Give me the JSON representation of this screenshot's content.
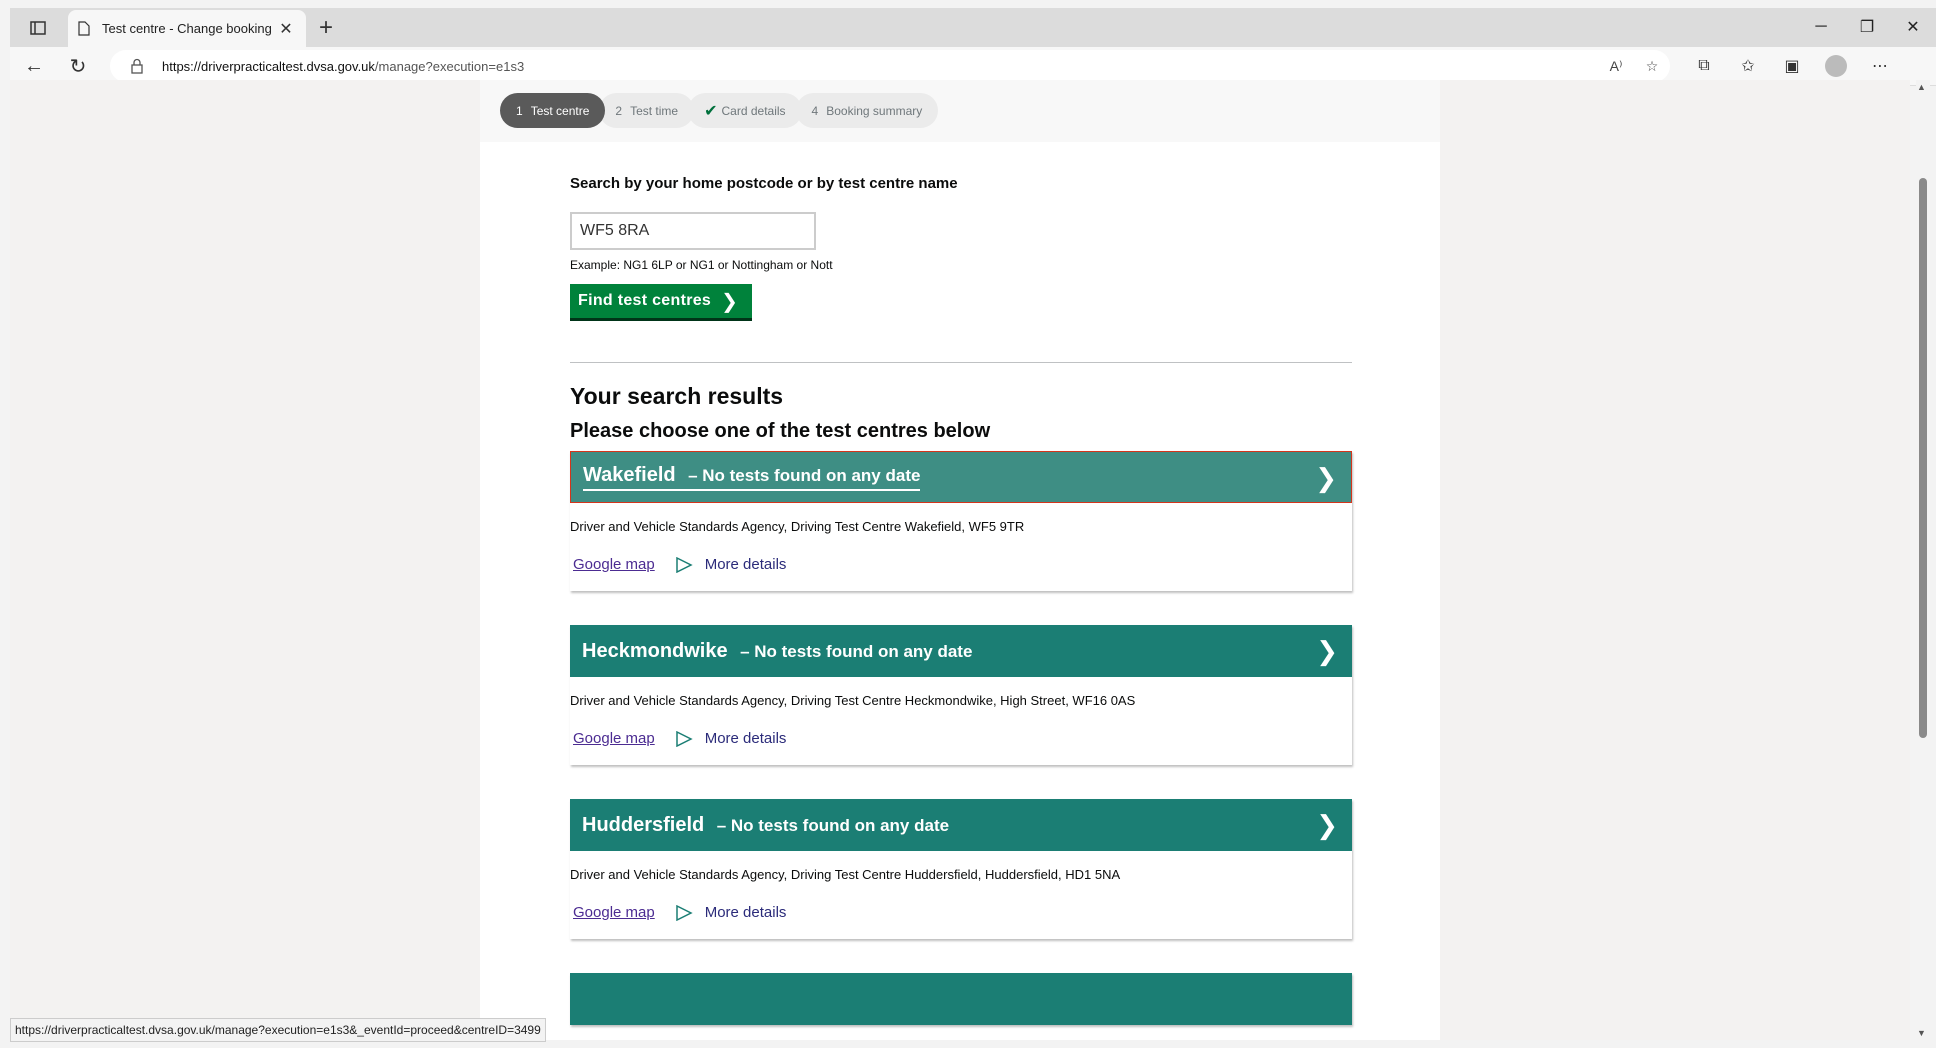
{
  "browser": {
    "tab_title": "Test centre - Change booking",
    "url_host": "https://driverpracticaltest.dvsa.gov.uk",
    "url_path": "/manage?execution=e1s3",
    "status_url": "https://driverpracticaltest.dvsa.gov.uk/manage?execution=e1s3&_eventId=proceed&centreID=3499"
  },
  "steps": [
    {
      "num": "1",
      "label": "Test centre"
    },
    {
      "num": "2",
      "label": "Test time"
    },
    {
      "num": "",
      "label": "Card details"
    },
    {
      "num": "4",
      "label": "Booking summary"
    }
  ],
  "search": {
    "label": "Search by your home postcode or by test centre name",
    "value": "WF5 8RA",
    "hint": "Example: NG1 6LP or NG1 or Nottingham or Nott",
    "button": "Find test centres"
  },
  "results": {
    "heading": "Your search results",
    "subheading": "Please choose one of the test centres below",
    "centres": [
      {
        "name": "Wakefield",
        "status": "– No tests found on any date",
        "address": "Driver and Vehicle Standards Agency, Driving Test Centre Wakefield, WF5 9TR",
        "map_link": "Google map",
        "more_link": "More details"
      },
      {
        "name": "Heckmondwike",
        "status": "– No tests found on any date",
        "address": "Driver and Vehicle Standards Agency, Driving Test Centre Heckmondwike, High Street, WF16 0AS",
        "map_link": "Google map",
        "more_link": "More details"
      },
      {
        "name": "Huddersfield",
        "status": "– No tests found on any date",
        "address": "Driver and Vehicle Standards Agency, Driving Test Centre Huddersfield, Huddersfield, HD1 5NA",
        "map_link": "Google map",
        "more_link": "More details"
      }
    ]
  },
  "colors": {
    "brand_teal": "#1b7e74",
    "button_green": "#00823b",
    "link_purple": "#4c2c92"
  }
}
